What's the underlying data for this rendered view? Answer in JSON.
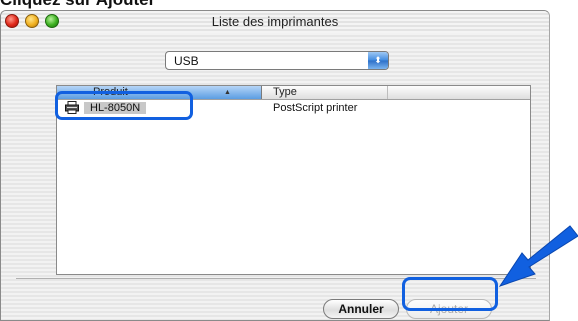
{
  "top_text": "Cliquez sur Ajouter",
  "window": {
    "title": "Liste des imprimantes"
  },
  "connection": {
    "selected": "USB",
    "arrows_glyph": "⬍"
  },
  "table": {
    "columns": [
      "Produit",
      "Type"
    ],
    "sort_indicator": "▲",
    "rows": [
      {
        "product": "HL-8050N",
        "type": "PostScript printer",
        "icon": "printer-icon"
      }
    ]
  },
  "buttons": {
    "cancel_label": "Annuler",
    "add_label": "Ajouter"
  },
  "colors": {
    "highlight": "#1160e0",
    "header_selected": "#5b9de2",
    "popup_accent": "#3f8ae0"
  }
}
